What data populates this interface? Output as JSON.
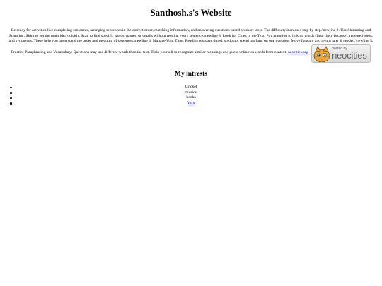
{
  "header": {
    "title": "Santhosh.s's Website"
  },
  "intro": {
    "text": "Be ready for activities like completing sentences, arranging sentences in the correct order, matching information, and answering questions based on short texts. The difficulty increases step by step.\\newline 2. Use Skimming and Scanning: Skim to get the main idea quickly. Scan to find specific words, names, or details without reading every sentence.\\newline 3. Look for Clues in the Text: Pay attention to linking words (first, then, because), repeated ideas, and synonyms. These help you understand the order and meaning of sentences.\\newline 4. Manage Your Time: Reading tests are timed, so do not spend too long on one question. Move forward and return later if needed.\\newline 5. Practice Paraphrasing and Vocabulary: Questions may use different words than the text. Train yourself to recognize similar meanings and guess unknown words from context.",
    "link_text": "neocities.org"
  },
  "badge": {
    "hosted_text": "hosted by",
    "brand_text": "neocities",
    "icon": "neocities-cat-icon"
  },
  "interests": {
    "heading": "My intrests",
    "items": [
      {
        "label": "Cricket",
        "link": false
      },
      {
        "label": "musics",
        "link": false
      },
      {
        "label": "books",
        "link": false
      },
      {
        "label": "Yarn",
        "link": true
      }
    ]
  },
  "colors": {
    "link": "#0000ee",
    "text": "#000000",
    "background": "#ffffff"
  }
}
